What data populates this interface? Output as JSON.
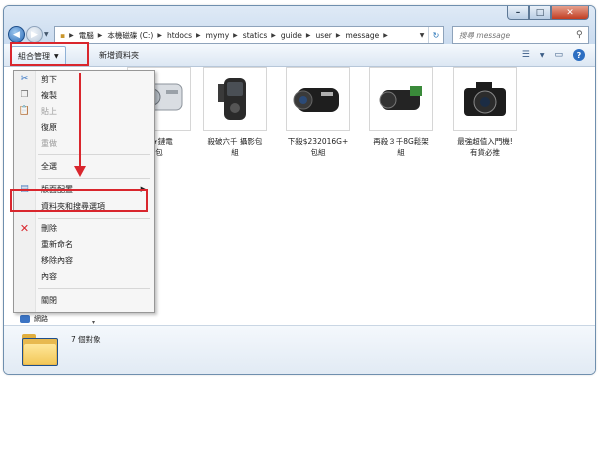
{
  "address": {
    "segments": [
      "電腦",
      "本機磁碟 (C:)",
      "htdocs",
      "mymy",
      "statics",
      "guide",
      "user",
      "message"
    ]
  },
  "search": {
    "placeholder": "搜尋 message"
  },
  "toolbar": {
    "organize": "組合管理",
    "new_folder": "新增資料夾"
  },
  "menu": {
    "cut": "剪下",
    "copy": "複製",
    "paste": "貼上",
    "undo": "復原",
    "redo": "重做",
    "select_all": "全選",
    "layout": "版面配置",
    "folder_options": "資料夾和搜尋選項",
    "delete": "刪除",
    "rename": "重新命名",
    "remove_props": "移除內容",
    "properties": "內容",
    "close": "關閉"
  },
  "files": [
    {
      "caption_line1": "G★鏈電",
      "caption_line2": "包",
      "icon": "camera-silver-icon"
    },
    {
      "caption_line1": "殺破六千 攝影包",
      "caption_line2": "組",
      "icon": "camcorder-black-icon"
    },
    {
      "caption_line1": "下殺$232016G+",
      "caption_line2": "包組",
      "icon": "camcorder-jvc-icon"
    },
    {
      "caption_line1": "再殺３千8G鬆架",
      "caption_line2": "組",
      "icon": "camcorder-hd-icon"
    },
    {
      "caption_line1": "最強超值入門機!",
      "caption_line2": "有貨必推",
      "icon": "dslr-camera-icon"
    }
  ],
  "nav": {
    "network": "網路"
  },
  "status": {
    "count": "7 個對象"
  },
  "colors": {
    "highlight": "#d9262d",
    "accent": "#2d6fc2"
  }
}
